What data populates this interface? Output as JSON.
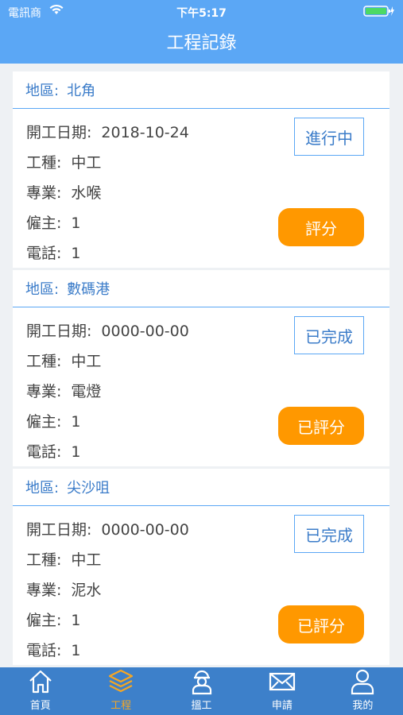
{
  "status_bar": {
    "carrier": "電訊商",
    "time": "下午5:17"
  },
  "header": {
    "title": "工程記錄"
  },
  "labels": {
    "region": "地區:",
    "start_date": "開工日期:",
    "trade": "工種:",
    "specialty": "專業:",
    "employer": "僱主:",
    "phone": "電話:"
  },
  "records": [
    {
      "region": "北角",
      "start_date": "2018-10-24",
      "trade": "中工",
      "specialty": "水喉",
      "employer": "1",
      "phone": "1",
      "status": "進行中",
      "rate_label": "評分"
    },
    {
      "region": "數碼港",
      "start_date": "0000-00-00",
      "trade": "中工",
      "specialty": "電燈",
      "employer": "1",
      "phone": "1",
      "status": "已完成",
      "rate_label": "已評分"
    },
    {
      "region": "尖沙咀",
      "start_date": "0000-00-00",
      "trade": "中工",
      "specialty": "泥水",
      "employer": "1",
      "phone": "1",
      "status": "已完成",
      "rate_label": "已評分"
    }
  ],
  "tabbar": {
    "active": "工程",
    "tabs": [
      {
        "label": "首頁",
        "icon": "home-icon"
      },
      {
        "label": "工程",
        "icon": "layers-icon"
      },
      {
        "label": "搵工",
        "icon": "worker-icon"
      },
      {
        "label": "申請",
        "icon": "mail-icon"
      },
      {
        "label": "我的",
        "icon": "person-icon"
      }
    ]
  },
  "colors": {
    "header": "#5ba7f5",
    "tabbar": "#3d80ca",
    "accent": "#ff9800",
    "link": "#3b7cc9",
    "active_tab": "#f5a623"
  }
}
